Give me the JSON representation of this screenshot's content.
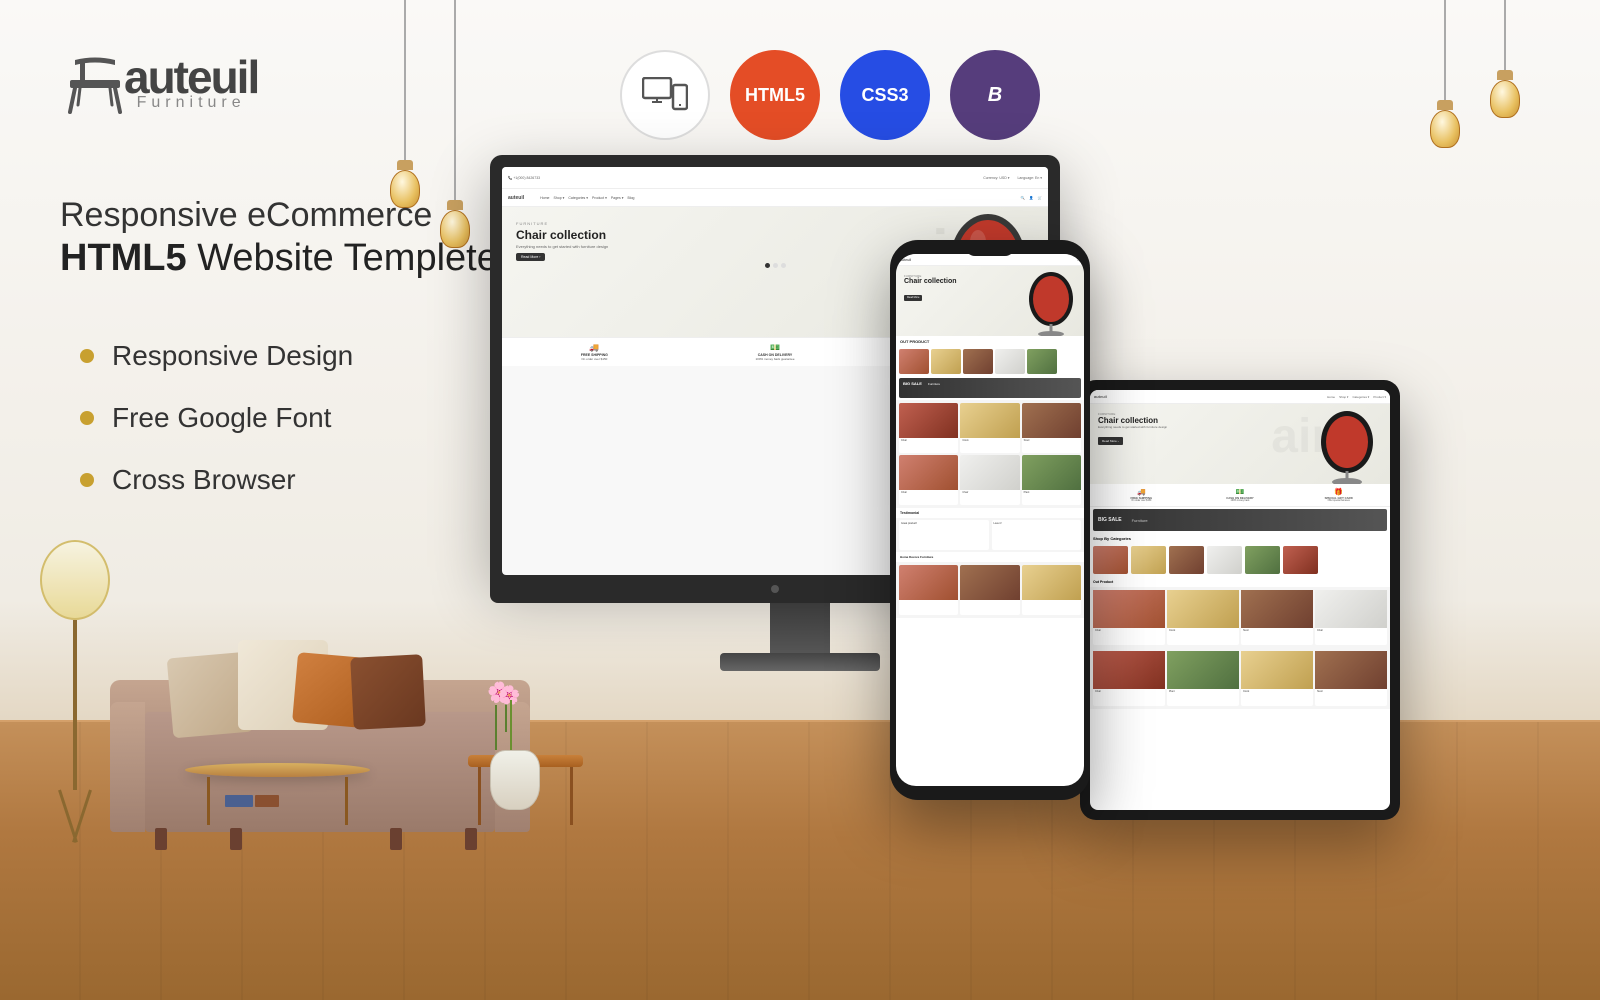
{
  "page": {
    "background_color": "#f5f5f2"
  },
  "logo": {
    "brand": "auteuil",
    "sub": "Furniture"
  },
  "headline": {
    "line1": "Responsive eCommerce",
    "line2_bold": "HTML5",
    "line2_rest": " Website Templete"
  },
  "features": [
    {
      "id": "responsive-design",
      "label": "Responsive Design"
    },
    {
      "id": "free-google-font",
      "label": "Free Google Font"
    },
    {
      "id": "cross-browser",
      "label": "Cross Browser"
    }
  ],
  "tech_icons": [
    {
      "id": "responsive",
      "label": "Responsive",
      "symbol": "⊞"
    },
    {
      "id": "html5",
      "label": "HTML5",
      "symbol": "H5"
    },
    {
      "id": "css3",
      "label": "CSS3",
      "symbol": "C3"
    },
    {
      "id": "bootstrap",
      "label": "Bootstrap",
      "symbol": "B"
    }
  ],
  "site_preview": {
    "phone_number": "+1(000) 8426733",
    "nav_items": [
      "Home",
      "Shop",
      "Categories",
      "Product",
      "Pages",
      "Blog"
    ],
    "hero": {
      "category": "FURNITURE",
      "title": "Chair collection",
      "subtitle": "Everything needs to get started with furniture design",
      "button": "Read More"
    },
    "features_bar": [
      {
        "icon": "🚚",
        "title": "FREE SHIPPING",
        "sub": "On order over $150"
      },
      {
        "icon": "💵",
        "title": "CASH ON DELIVERY",
        "sub": "100% money back guarantee"
      },
      {
        "icon": "🎁",
        "title": "SPECIAL GIFT CARD",
        "sub": "Offer special bonuses with gift"
      }
    ]
  },
  "pendant_lights": [
    {
      "cord_height": 120
    },
    {
      "cord_height": 80
    }
  ],
  "pendant_left": [
    {
      "cord_height": 200
    },
    {
      "cord_height": 160
    }
  ]
}
